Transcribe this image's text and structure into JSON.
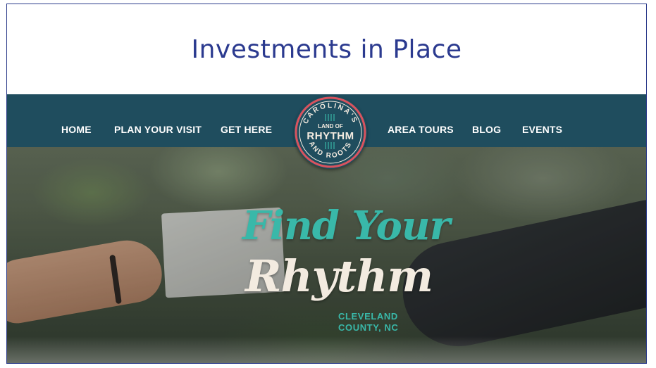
{
  "slide": {
    "title": "Investments in Place"
  },
  "nav": {
    "items": [
      "HOME",
      "PLAN YOUR VISIT",
      "GET HERE",
      "AREA TOURS",
      "BLOG",
      "EVENTS"
    ]
  },
  "logo": {
    "top_text": "CAROLINA'S",
    "mid_text": "LAND OF",
    "main_text": "RHYTHM",
    "bottom_text": "AND ROOTS",
    "icon": "guitar-strings-icon"
  },
  "hero": {
    "line1": "Find Your",
    "line2": "Rhythm",
    "place_line1": "CLEVELAND",
    "place_line2": "COUNTY, NC"
  },
  "colors": {
    "title": "#2b3a8f",
    "nav_bg": "#1f4d5e",
    "teal": "#39b8a9",
    "cream": "#f3ebe0",
    "logo_accent": "#d9535e"
  }
}
